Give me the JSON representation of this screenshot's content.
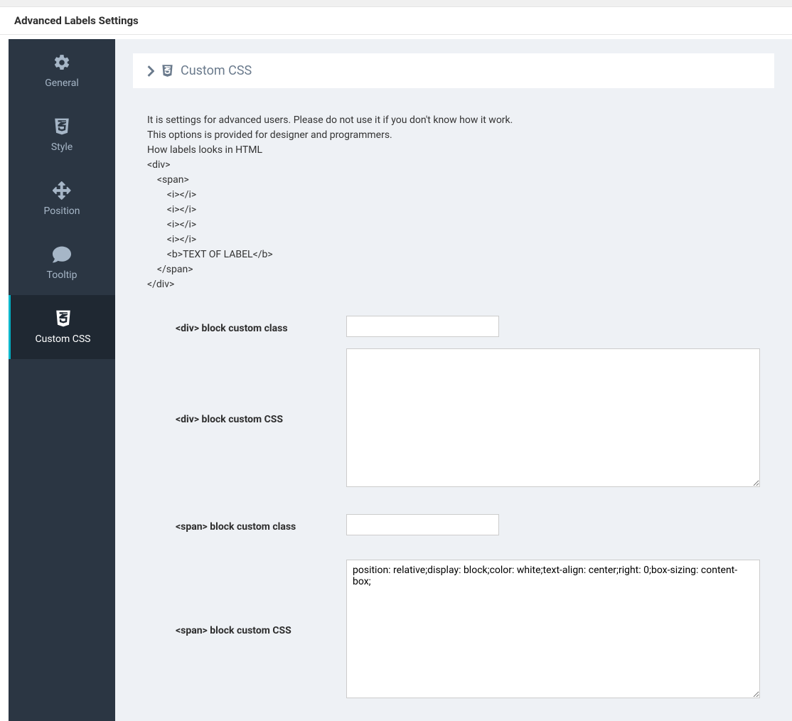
{
  "header": {
    "title": "Advanced Labels Settings"
  },
  "sidebar": {
    "items": [
      {
        "label": "General",
        "icon": "gear",
        "active": false
      },
      {
        "label": "Style",
        "icon": "css3",
        "active": false
      },
      {
        "label": "Position",
        "icon": "arrows",
        "active": false
      },
      {
        "label": "Tooltip",
        "icon": "comment",
        "active": false
      },
      {
        "label": "Custom CSS",
        "icon": "css3",
        "active": true
      }
    ]
  },
  "panel": {
    "title": "Custom CSS"
  },
  "intro": {
    "line1": "It is settings for advanced users. Please do not use it if you don't know how it work.",
    "line2": "This options is provided for designer and programmers.",
    "line3": "How labels looks in HTML",
    "code": {
      "l1": "<div>",
      "l2": "    <span>",
      "l3": "        <i></i>",
      "l4": "        <i></i>",
      "l5": "        <i></i>",
      "l6": "        <i></i>",
      "l7": "        <b>TEXT OF LABEL</b>",
      "l8": "    </span>",
      "l9": "</div>"
    }
  },
  "fields": {
    "div_class": {
      "label": "<div> block custom class",
      "value": ""
    },
    "div_css": {
      "label": "<div> block custom CSS",
      "value": ""
    },
    "span_class": {
      "label": "<span> block custom class",
      "value": ""
    },
    "span_css": {
      "label": "<span> block custom CSS",
      "value": "position: relative;display: block;color: white;text-align: center;right: 0;box-sizing: content-box;"
    }
  }
}
